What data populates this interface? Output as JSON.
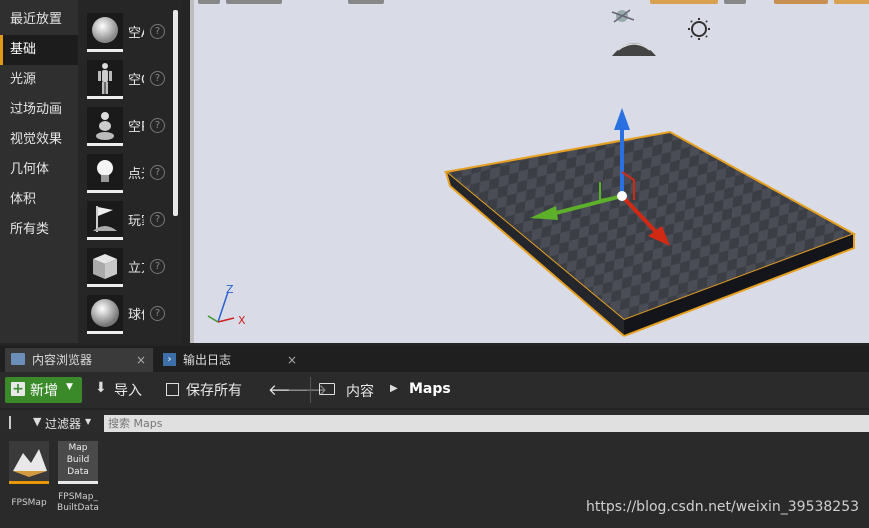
{
  "place_panel": {
    "categories": [
      {
        "label": "最近放置"
      },
      {
        "label": "基础"
      },
      {
        "label": "光源"
      },
      {
        "label": "过场动画"
      },
      {
        "label": "视觉效果"
      },
      {
        "label": "几何体"
      },
      {
        "label": "体积"
      },
      {
        "label": "所有类"
      }
    ],
    "items": [
      {
        "label": "空Actor",
        "icon": "sphere-icon"
      },
      {
        "label": "空Character",
        "icon": "mannequin-icon"
      },
      {
        "label": "空Pawn",
        "icon": "pawn-icon"
      },
      {
        "label": "点光源",
        "icon": "lightbulb-icon"
      },
      {
        "label": "玩家出生点",
        "icon": "player-start-icon"
      },
      {
        "label": "立方体",
        "icon": "cube-icon"
      },
      {
        "label": "球体",
        "icon": "sphere-icon"
      }
    ],
    "help_glyph": "?"
  },
  "viewport": {
    "axis_labels": {
      "z": "Z",
      "x": "X"
    }
  },
  "tabs": [
    {
      "label": "内容浏览器",
      "icon": "content-browser-icon"
    },
    {
      "label": "输出日志",
      "icon": "output-log-icon"
    }
  ],
  "close_glyph": "×",
  "toolbar": {
    "add_label": "新增",
    "import_label": "导入",
    "save_all_label": "保存所有",
    "breadcrumb": [
      "内容",
      "Maps"
    ]
  },
  "filter": {
    "filters_label": "过滤器",
    "search_placeholder": "搜索 Maps"
  },
  "assets": [
    {
      "name": "FPSMap",
      "thumb_text": ""
    },
    {
      "name": "FPSMap_BuiltData",
      "thumb_text": "Map Build Data"
    }
  ],
  "asset_name_lines": [
    "FPSMap_",
    "BuiltData"
  ],
  "thumb_text_lines": [
    "Map",
    "Build",
    "Data"
  ],
  "watermark": "https://blog.csdn.net/weixin_39538253",
  "colors": {
    "accent": "#e09a1a",
    "add_button": "#3a8a2a",
    "viewport_bg": "#d9dbe6"
  }
}
